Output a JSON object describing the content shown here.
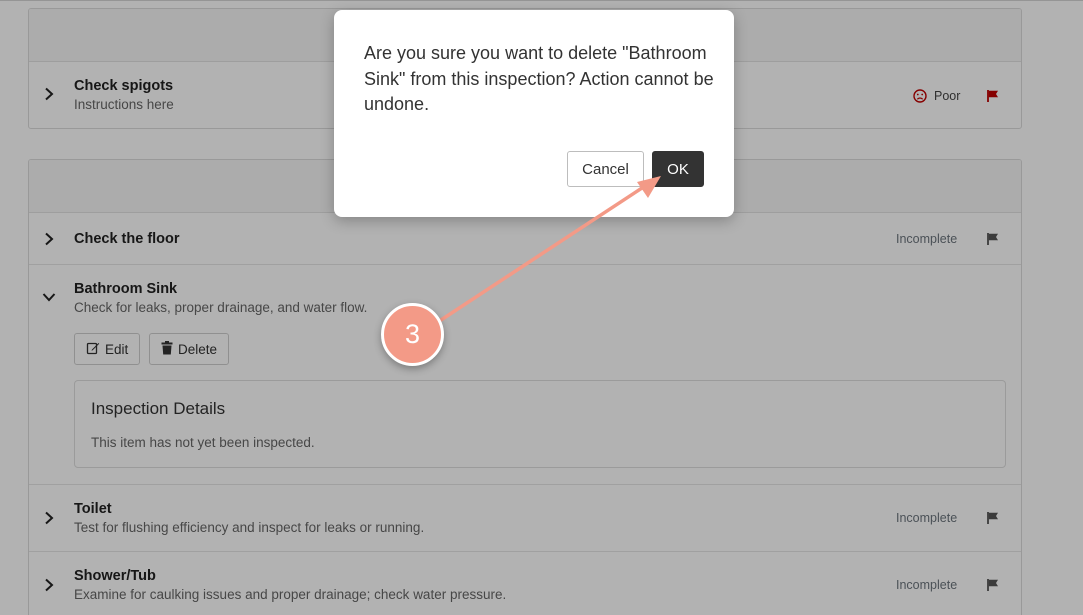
{
  "sections": [
    {
      "items": [
        {
          "title": "Check spigots",
          "subtitle": "Instructions here",
          "status": "Poor",
          "status_icon": "frown-icon",
          "flag_color": "#c00000"
        }
      ]
    },
    {
      "items": [
        {
          "title": "Check the floor",
          "subtitle": "",
          "status": "Incomplete",
          "flag_color": "#555555"
        },
        {
          "title": "Bathroom Sink",
          "subtitle": "Check for leaks, proper drainage, and water flow.",
          "expanded": true,
          "actions": {
            "edit_label": "Edit",
            "delete_label": "Delete"
          },
          "details": {
            "title": "Inspection Details",
            "text": "This item has not yet been inspected."
          }
        },
        {
          "title": "Toilet",
          "subtitle": "Test for flushing efficiency and inspect for leaks or running.",
          "status": "Incomplete",
          "flag_color": "#555555"
        },
        {
          "title": "Shower/Tub",
          "subtitle": "Examine for caulking issues and proper drainage; check water pressure.",
          "status": "Incomplete",
          "flag_color": "#555555"
        }
      ]
    }
  ],
  "modal": {
    "message": "Are you sure you want to delete \"Bathroom Sink\" from this inspection? Action cannot be undone.",
    "cancel_label": "Cancel",
    "ok_label": "OK"
  },
  "annotation": {
    "step": "3",
    "color": "#f39a87"
  }
}
